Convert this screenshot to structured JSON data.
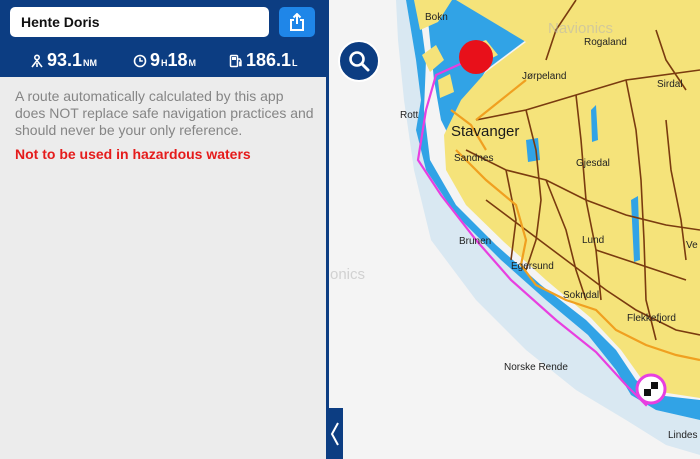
{
  "route": {
    "name": "Hente Doris"
  },
  "stats": {
    "distance": {
      "value": "93.1",
      "unit": "NM",
      "icon": "route-distance-icon"
    },
    "duration": {
      "hours": "9",
      "h_unit": "H",
      "minutes": "18",
      "m_unit": "M",
      "icon": "clock-icon"
    },
    "fuel": {
      "value": "186.1",
      "unit": "L",
      "icon": "fuel-pump-icon"
    }
  },
  "disclaimer": "A route automatically calculated by this app does NOT replace safe navigation practices and should never be your only reference.",
  "warning": "Not to be used in hazardous waters",
  "map": {
    "places": {
      "bokn": "Bokn",
      "rogaland": "Rogaland",
      "jorpeland": "Jørpeland",
      "sirdal": "Sirdal",
      "rott": "Rott",
      "stavanger": "Stavanger",
      "sandnes": "Sandnes",
      "gjesdal": "Gjesdal",
      "lund": "Lund",
      "ve": "Ve",
      "braunen": "Brunen",
      "egersund": "Egersund",
      "sokndal": "Sokndal",
      "flekkefjord": "Flekkefjord",
      "norske_rende": "Norske Rende",
      "lindesnes": "Lindes"
    },
    "watermark_top": "Navionics",
    "watermark_mid": "onics"
  },
  "colors": {
    "header": "#0c3d82",
    "accent": "#1f86e8",
    "warning": "#e51b1b",
    "land": "#f5e37a",
    "water": "#31a3e6",
    "route": "#e83fe0",
    "roads": "#7a3b0f"
  }
}
